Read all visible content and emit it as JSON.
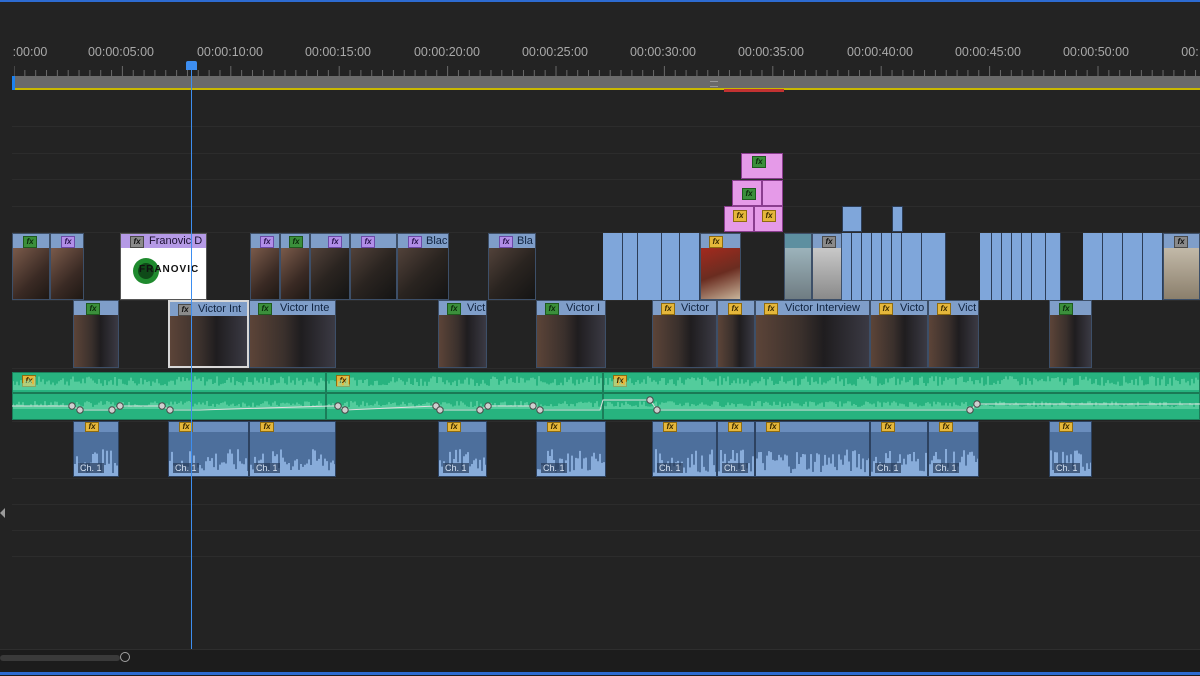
{
  "ruler": {
    "timecodes": [
      ":00:00",
      "00:00:05:00",
      "00:00:10:00",
      "00:00:15:00",
      "00:00:20:00",
      "00:00:25:00",
      "00:00:30:00",
      "00:00:35:00",
      "00:00:40:00",
      "00:00:45:00",
      "00:00:50:00",
      "00:"
    ]
  },
  "clips": {
    "franovic_label": "Franovic D",
    "franovic_logo_text": "FRANOVIC",
    "black_label_1": "Blac",
    "black_label_2": "Bla",
    "victor_labels": [
      "Victor Int",
      "Victor Inte",
      "Vict",
      "Victor I",
      "Victor",
      "Victor Interview",
      "Victo",
      "Vict"
    ],
    "fx": "fx",
    "channel_label": "Ch. 1"
  },
  "colors": {
    "accent": "#2d6bd1",
    "playhead": "#3d8ef0",
    "audio_green": "#27b37f",
    "video_blue": "#7fa6da",
    "pink": "#e59ae8"
  }
}
